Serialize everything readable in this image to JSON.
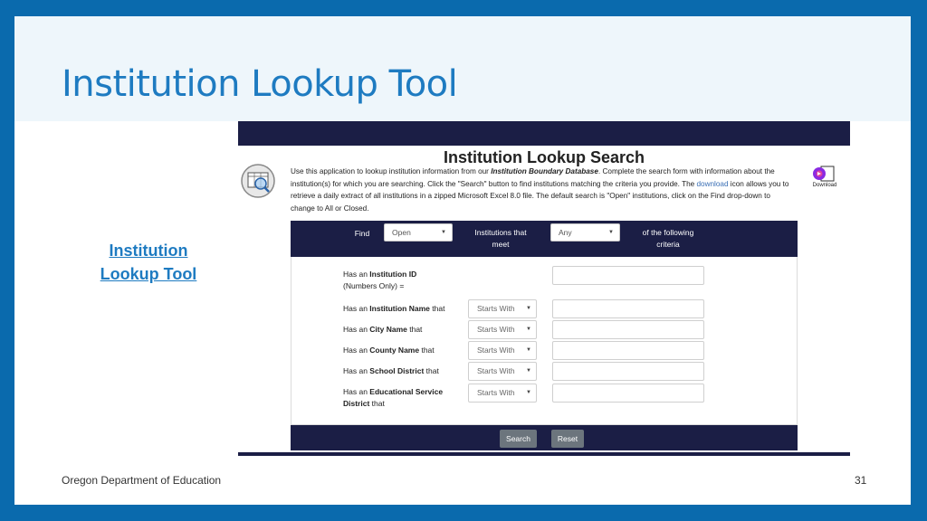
{
  "slide": {
    "title": "Institution Lookup Tool",
    "side_link_line1": "Institution",
    "side_link_line2": "Lookup Tool",
    "footer_org": "Oregon Department of Education",
    "page_number": "31"
  },
  "app": {
    "heading": "Institution Lookup Search",
    "desc_part1": "Use this application to lookup institution information from our ",
    "desc_db": "Institution Boundary Database",
    "desc_part2": ". Complete the search form with information about the institution(s) for which you are searching. Click the \"Search\" button to find institutions matching the criteria you provide. The ",
    "desc_link": "download",
    "desc_part3": " icon allows you to retrieve a daily extract of all institutions in a zipped Microsoft Excel 8.0 file. The default search is \"Open\" institutions, click on the Find drop-down to change to All or Closed.",
    "download_label": "Download",
    "criteria": {
      "find_label": "Find",
      "find_value": "Open",
      "meet_label_line1": "Institutions that",
      "meet_label_line2": "meet",
      "match_value": "Any",
      "following_line1": "of the following",
      "following_line2": "criteria"
    },
    "rows": [
      {
        "prefix": "Has an ",
        "field": "Institution ID",
        "suffix": "",
        "line2": "(Numbers Only) =",
        "select": ""
      },
      {
        "prefix": "Has an ",
        "field": "Institution Name",
        "suffix": " that",
        "line2": "",
        "select": "Starts With"
      },
      {
        "prefix": "Has an ",
        "field": "City Name",
        "suffix": " that",
        "line2": "",
        "select": "Starts With"
      },
      {
        "prefix": "Has an ",
        "field": "County Name",
        "suffix": " that",
        "line2": "",
        "select": "Starts With"
      },
      {
        "prefix": "Has an ",
        "field": "School District",
        "suffix": " that",
        "line2": "",
        "select": "Starts With"
      },
      {
        "prefix": "Has an ",
        "field": "Educational Service",
        "suffix": "",
        "line2_bold": "District",
        "line2": " that",
        "select": "Starts With"
      }
    ],
    "buttons": {
      "search": "Search",
      "reset": "Reset"
    }
  },
  "colors": {
    "accent": "#1e7bc1",
    "navy": "#1b1e45",
    "button_gray": "#6c757d",
    "frame_blue": "#0a6aad"
  }
}
